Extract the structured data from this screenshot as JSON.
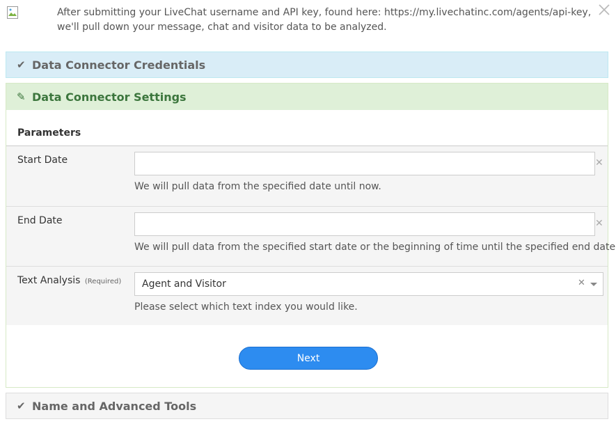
{
  "intro": {
    "text": "After submitting your LiveChat username and API key, found here: https://my.livechatinc.com/agents/api-key, we'll pull down your message, chat and visitor data to be analyzed."
  },
  "sections": {
    "credentials": {
      "title": "Data Connector Credentials",
      "icon": "check-icon"
    },
    "settings": {
      "title": "Data Connector Settings",
      "icon": "pencil-icon"
    },
    "advanced": {
      "title": "Name and Advanced Tools",
      "icon": "check-icon"
    }
  },
  "parameters": {
    "heading": "Parameters",
    "start_date": {
      "label": "Start Date",
      "value": "",
      "help": "We will pull data from the specified date until now."
    },
    "end_date": {
      "label": "End Date",
      "value": "",
      "help": "We will pull data from the specified start date or the beginning of time until the specified end date"
    },
    "text_analysis": {
      "label": "Text Analysis",
      "required": "(Required)",
      "selected": "Agent and Visitor",
      "help": "Please select which text index you would like."
    }
  },
  "buttons": {
    "next": "Next"
  },
  "colors": {
    "credentials_bg": "#d9edf7",
    "settings_bg": "#dff0d8",
    "settings_text": "#3c763d",
    "next_button": "#2d8cf0"
  }
}
